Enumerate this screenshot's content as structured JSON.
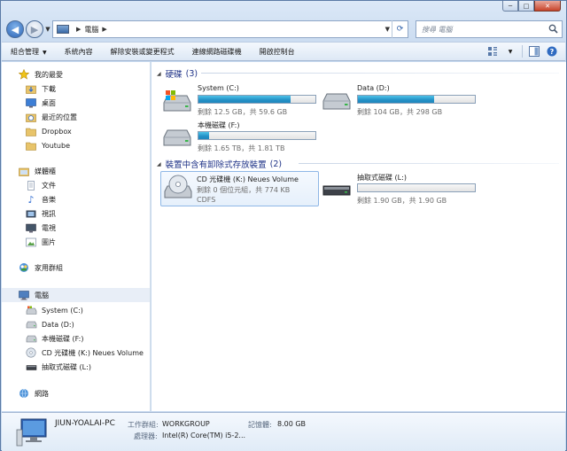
{
  "window": {
    "caption": {
      "minimize": "─",
      "maximize": "□",
      "close": "✕"
    }
  },
  "address_bar": {
    "crumbs": [
      "電腦"
    ],
    "back": "◀",
    "forward": "▶",
    "search_placeholder": "搜尋 電腦"
  },
  "toolbar": {
    "items": [
      {
        "label": "組合管理",
        "dropdown": true
      },
      {
        "label": "系統內容"
      },
      {
        "label": "解除安裝或變更程式"
      },
      {
        "label": "連線網路磁碟機"
      },
      {
        "label": "開啟控制台"
      }
    ]
  },
  "sidebar": {
    "favorites": {
      "header": "我的最愛",
      "items": [
        "下載",
        "桌面",
        "最近的位置",
        "Dropbox",
        "Youtube"
      ]
    },
    "libraries": {
      "header": "媒體櫃",
      "items": [
        "文件",
        "音樂",
        "視訊",
        "電視",
        "圖片"
      ]
    },
    "homegroup": "家用群組",
    "computer": {
      "header": "電腦",
      "items": [
        "System (C:)",
        "Data (D:)",
        "本機磁碟 (F:)",
        "CD 光碟機 (K:) Neues Volume",
        "抽取式磁碟 (L:)"
      ]
    },
    "network": "網路"
  },
  "main": {
    "hard_disks": {
      "title": "硬碟",
      "count": "(3)",
      "drives": [
        {
          "name": "System (C:)",
          "free": "剩餘 12.5 GB，共 59.6 GB",
          "used_fraction": 0.79
        },
        {
          "name": "Data (D:)",
          "free": "剩餘 104 GB，共 298 GB",
          "used_fraction": 0.65
        },
        {
          "name": "本機磁碟 (F:)",
          "free": "剩餘 1.65 TB，共 1.81 TB",
          "used_fraction": 0.09
        }
      ]
    },
    "removable": {
      "title": "裝置中含有卸除式存放裝置",
      "count": "(2)",
      "drives": [
        {
          "name": "CD 光碟機 (K:) Neues Volume",
          "free": "剩餘 0 個位元組，共 774 KB",
          "fs": "CDFS"
        },
        {
          "name": "抽取式磁碟 (L:)",
          "free": "剩餘 1.90 GB，共 1.90 GB",
          "used_fraction": 0.0
        }
      ]
    }
  },
  "details": {
    "pc_name": "JIUN-YOALAI-PC",
    "workgroup_label": "工作群組:",
    "workgroup": "WORKGROUP",
    "memory_label": "記憶體:",
    "memory": "8.00 GB",
    "processor_label": "處理器:",
    "processor": "Intel(R) Core(TM) i5-2..."
  },
  "colors": {
    "accent": "#1e3287",
    "bar_fill": "#2390c6"
  }
}
